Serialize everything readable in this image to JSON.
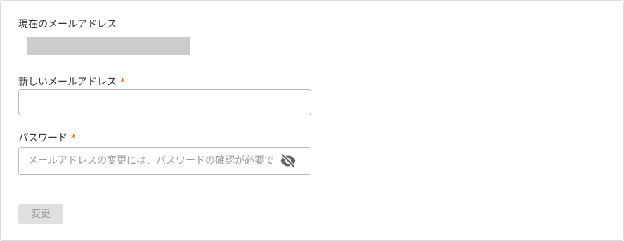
{
  "form": {
    "current_email": {
      "label": "現在のメールアドレス",
      "value_masked": true
    },
    "new_email": {
      "label": "新しいメールアドレス",
      "required_mark": "*",
      "value": "",
      "placeholder": ""
    },
    "password": {
      "label": "パスワード",
      "required_mark": "*",
      "value": "",
      "placeholder": "メールアドレスの変更には、パスワードの確認が必要です",
      "visibility_icon": "eye-slash-icon"
    },
    "submit_label": "変更",
    "submit_disabled": true
  },
  "colors": {
    "required_mark": "#e35b00",
    "button_disabled_bg": "#e0e0e0",
    "button_disabled_text": "#9b9b9b",
    "input_border": "#b9b9b9",
    "masked_value": "#cccccc"
  }
}
